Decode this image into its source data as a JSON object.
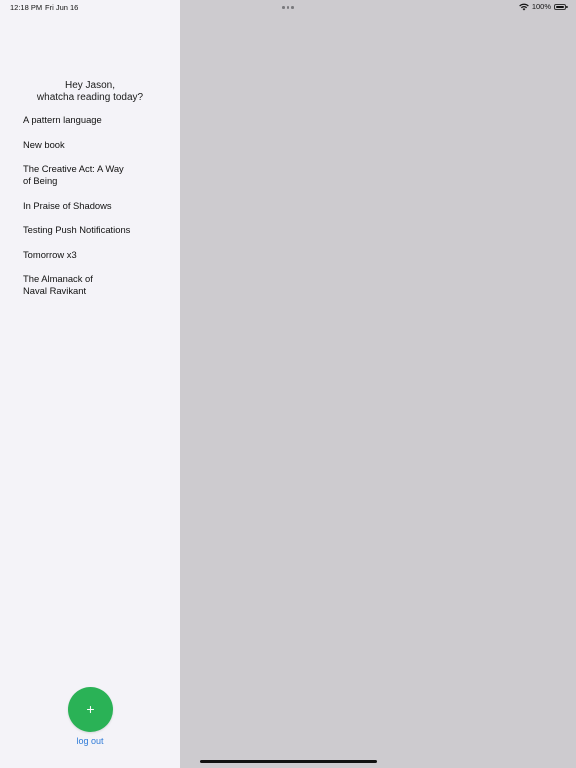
{
  "status_bar": {
    "time": "12:18 PM",
    "date": "Fri Jun 16",
    "battery_percent": "100%",
    "battery_level": 1.0
  },
  "sidebar": {
    "greeting_line1": "Hey Jason,",
    "greeting_line2": "whatcha reading today?",
    "books": [
      {
        "title": "A pattern language"
      },
      {
        "title": "New book"
      },
      {
        "title": "The Creative Act: A Way of Being"
      },
      {
        "title": "In Praise of Shadows"
      },
      {
        "title": "Testing Push Notifications"
      },
      {
        "title": "Tomorrow x3"
      },
      {
        "title": "The Almanack of Naval Ravikant"
      }
    ],
    "add_button_label": "+",
    "logout_label": "log out"
  },
  "colors": {
    "sidebar_bg": "#f4f3f8",
    "detail_bg": "#cdcbcf",
    "accent_green": "#2ab256",
    "link_blue": "#2f7bd8"
  },
  "icons": {
    "wifi": "wifi-icon",
    "battery": "battery-icon",
    "add": "plus-icon"
  }
}
